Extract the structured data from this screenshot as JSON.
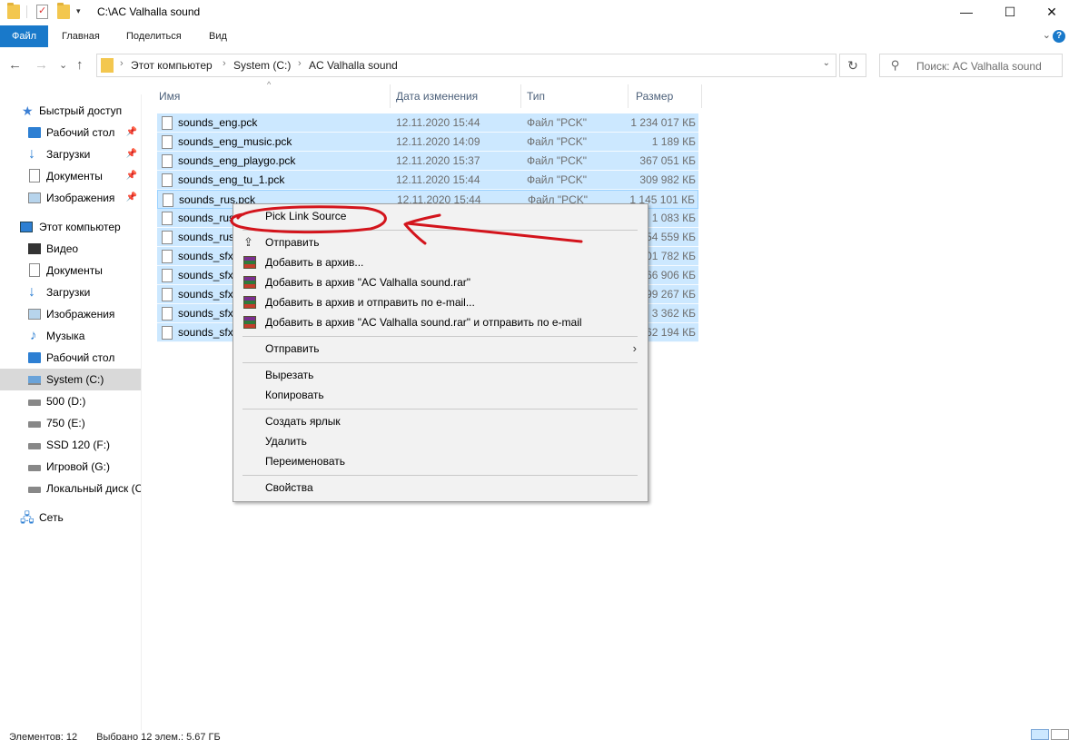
{
  "window": {
    "title": "C:\\AC Valhalla sound",
    "minimize_glyph": "—",
    "maximize_glyph": "☐",
    "close_glyph": "✕",
    "quick_access_dropdown": "▾"
  },
  "ribbon": {
    "tabs": [
      "Файл",
      "Главная",
      "Поделиться",
      "Вид"
    ],
    "expand_glyph": "⌄",
    "help_glyph": "?"
  },
  "address_bar": {
    "back_glyph": "←",
    "forward_glyph": "→",
    "recent_glyph": "⌄",
    "up_glyph": "↑",
    "crumbs": [
      "Этот компьютер",
      "System (C:)",
      "AC Valhalla sound"
    ],
    "crumb_separator": "›",
    "dropdown_glyph": "⌄",
    "refresh_glyph": "↻",
    "search_placeholder": "Поиск: AC Valhalla sound",
    "search_glyph": "⚲"
  },
  "sidebar": {
    "quick_access": "Быстрый доступ",
    "quick_items": [
      "Рабочий стол",
      "Загрузки",
      "Документы",
      "Изображения"
    ],
    "pin_glyph": "📌",
    "this_pc": "Этот компьютер",
    "pc_items": [
      "Видео",
      "Документы",
      "Загрузки",
      "Изображения",
      "Музыка",
      "Рабочий стол",
      "System (C:)",
      "500 (D:)",
      "750 (E:)",
      "SSD 120 (F:)",
      "Игровой (G:)",
      "Локальный диск (С"
    ],
    "network": "Сеть",
    "selected": "System (C:)"
  },
  "file_list": {
    "columns": [
      "Имя",
      "Дата изменения",
      "Тип",
      "Размер"
    ],
    "sort_glyph": "^",
    "rows": [
      {
        "name": "sounds_eng.pck",
        "date": "12.11.2020 15:44",
        "type": "Файл \"PCK\"",
        "size": "1 234 017 КБ"
      },
      {
        "name": "sounds_eng_music.pck",
        "date": "12.11.2020 14:09",
        "type": "Файл \"PCK\"",
        "size": "1 189 КБ"
      },
      {
        "name": "sounds_eng_playgo.pck",
        "date": "12.11.2020 15:37",
        "type": "Файл \"PCK\"",
        "size": "367 051 КБ"
      },
      {
        "name": "sounds_eng_tu_1.pck",
        "date": "12.11.2020 15:44",
        "type": "Файл \"PCK\"",
        "size": "309 982 КБ"
      },
      {
        "name": "sounds_rus.pck",
        "date": "12.11.2020 15:44",
        "type": "Файл \"PCK\"",
        "size": "1 145 101 КБ"
      },
      {
        "name": "sounds_rus",
        "date": "",
        "type": "",
        "size": "1 083 КБ"
      },
      {
        "name": "sounds_rus",
        "date": "",
        "type": "",
        "size": "354 559 КБ"
      },
      {
        "name": "sounds_sfx",
        "date": "",
        "type": "",
        "size": "301 782 КБ"
      },
      {
        "name": "sounds_sfx",
        "date": "",
        "type": "",
        "size": "766 906 КБ"
      },
      {
        "name": "sounds_sfx",
        "date": "",
        "type": "",
        "size": "799 267 КБ"
      },
      {
        "name": "sounds_sfx",
        "date": "",
        "type": "",
        "size": "3 362 КБ"
      },
      {
        "name": "sounds_sfx",
        "date": "",
        "type": "",
        "size": "62 194 КБ"
      }
    ]
  },
  "context_menu": {
    "pick_link_source": "Pick Link Source",
    "share": "Отправить",
    "add_archive": "Добавить в архив...",
    "add_to_rar": "Добавить в архив \"AC Valhalla sound.rar\"",
    "add_and_email": "Добавить в архив и отправить по e-mail...",
    "add_rar_and_email": "Добавить в архив \"AC Valhalla sound.rar\" и отправить по e-mail",
    "send_to": "Отправить",
    "submenu_glyph": "›",
    "cut": "Вырезать",
    "copy": "Копировать",
    "create_shortcut": "Создать ярлык",
    "delete": "Удалить",
    "rename": "Переименовать",
    "properties": "Свойства"
  },
  "status_bar": {
    "items_count": "Элементов: 12",
    "selected": "Выбрано 12 элем.: 5,67 ГБ"
  },
  "colors": {
    "accent": "#1979ca",
    "selection": "#cce8ff",
    "annotation": "#d3141c"
  }
}
